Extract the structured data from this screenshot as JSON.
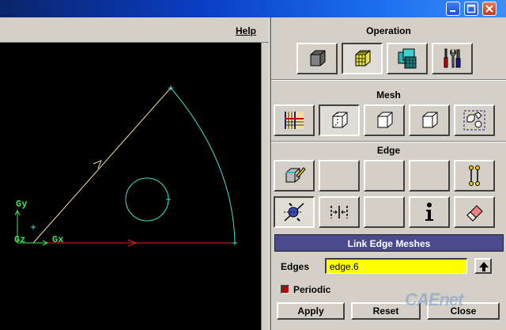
{
  "menubar": {
    "help_label": "Help"
  },
  "viewport": {
    "axis_labels": {
      "gy": "Gy",
      "gz": "Gz",
      "gx": "Gx"
    },
    "colors": {
      "background": "#000000",
      "geometry": "#40e0d0",
      "x_axis": "#e02020",
      "labels": "#40e060",
      "edge_arrow": "#ffe0a0"
    }
  },
  "panel": {
    "operation": {
      "title": "Operation",
      "buttons": [
        "geometry-icon",
        "mesh-icon",
        "zones-icon",
        "tools-icon"
      ]
    },
    "mesh": {
      "title": "Mesh",
      "buttons": [
        "boundary-layer-icon",
        "mesh-edges-icon",
        "mesh-faces-icon",
        "mesh-volumes-icon",
        "mesh-group-icon"
      ]
    },
    "edge": {
      "title": "Edge",
      "buttons_row1": [
        "mesh-edge-icon",
        "blank",
        "blank",
        "blank",
        "edge-nodes-icon"
      ],
      "buttons_row2": [
        "link-edge-icon",
        "edge-grading-icon",
        "blank",
        "info-icon",
        "eraser-icon"
      ]
    },
    "link_edge": {
      "title": "Link Edge Meshes",
      "edges_label": "Edges",
      "edges_value": "edge.6",
      "periodic_label": "Periodic",
      "periodic_checked": true,
      "apply_label": "Apply",
      "reset_label": "Reset",
      "close_label": "Close"
    }
  },
  "watermark": "CAEnet"
}
